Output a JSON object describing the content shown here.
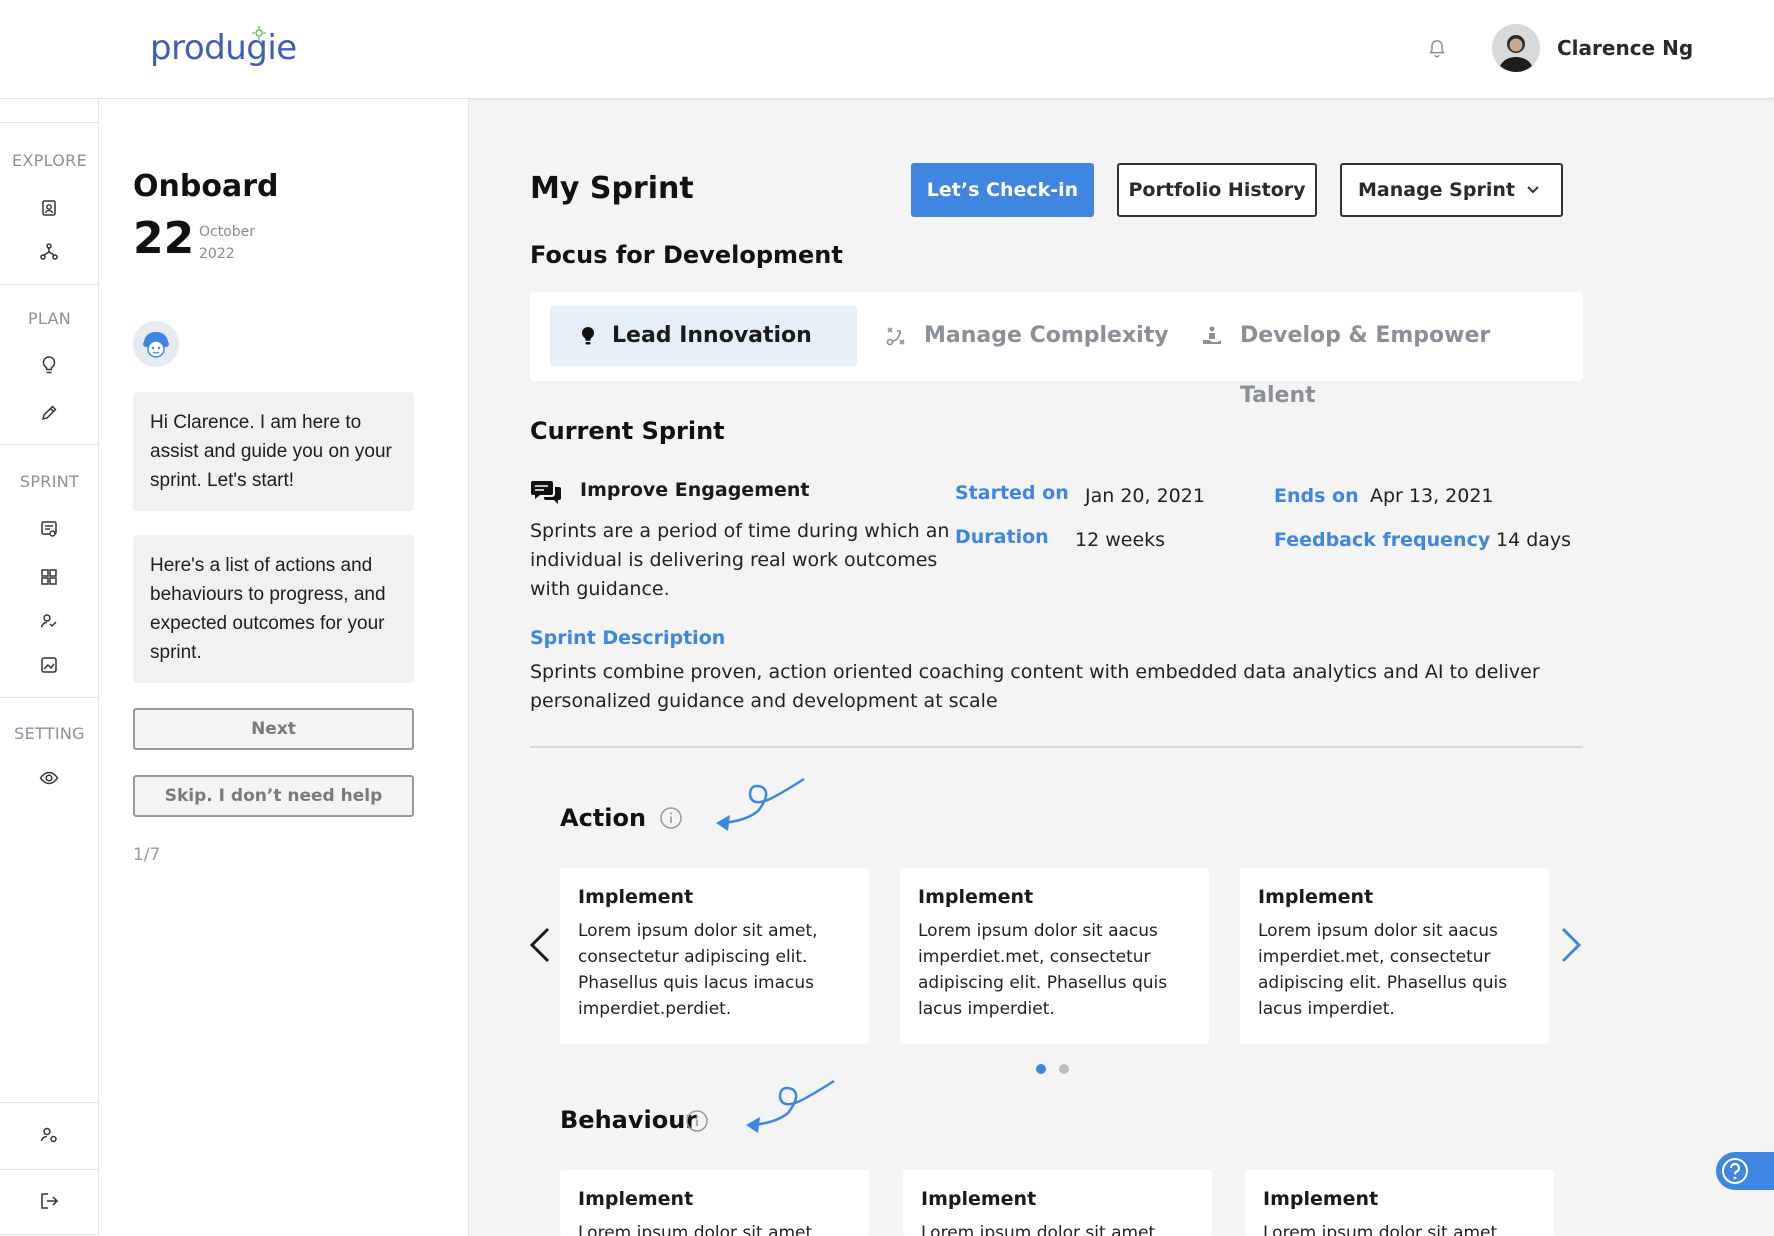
{
  "header": {
    "logo": "produgie",
    "user_name": "Clarence Ng"
  },
  "rail": {
    "sections": [
      {
        "label": "EXPLORE",
        "icons": [
          "profile-badge-icon",
          "org-tree-icon"
        ]
      },
      {
        "label": "PLAN",
        "icons": [
          "lightbulb-icon",
          "pencil-icon"
        ]
      },
      {
        "label": "SPRINT",
        "icons": [
          "sprint-board-icon",
          "grid-icon",
          "person-check-icon",
          "image-chart-icon"
        ]
      },
      {
        "label": "SETTING",
        "icons": [
          "eye-icon"
        ]
      }
    ],
    "bottom_icons": [
      "user-settings-icon",
      "logout-icon"
    ]
  },
  "onboard": {
    "title": "Onboard",
    "day": "22",
    "month": "October",
    "year": "2022",
    "messages": [
      "Hi Clarence. I am here to assist and guide you on your sprint. Let's start!",
      "Here's a list of actions and behaviours to progress, and expected outcomes for your sprint."
    ],
    "next_label": "Next",
    "skip_label": "Skip. I don’t need help",
    "progress": "1/7"
  },
  "main": {
    "title": "My Sprint",
    "checkin_label": "Let’s Check-in",
    "portfolio_label": "Portfolio History",
    "manage_label": "Manage Sprint",
    "focus_heading": "Focus for Development",
    "focus_tabs": [
      {
        "label": "Lead Innovation",
        "icon": "lightbulb-icon",
        "active": true
      },
      {
        "label": "Manage Complexity",
        "icon": "strategy-icon",
        "active": false
      },
      {
        "label": "Develop & Empower Talent",
        "icon": "hand-person-icon",
        "active": false
      }
    ],
    "current_heading": "Current Sprint",
    "sprint": {
      "name": "Improve Engagement",
      "description": "Sprints are a period of time during which an individual is delivering real work outcomes with guidance.",
      "started_label": "Started on",
      "started_value": "Jan 20, 2021",
      "ends_label": "Ends on",
      "ends_value": "Apr 13, 2021",
      "duration_label": "Duration",
      "duration_value": "12 weeks",
      "feedback_label": "Feedback frequency",
      "feedback_value": "14 days",
      "desc_title": "Sprint Description",
      "desc_body": "Sprints combine proven, action oriented coaching content with embedded data analytics and AI to deliver personalized guidance and development at scale"
    },
    "action": {
      "title": "Action",
      "cards": [
        {
          "title": "Implement",
          "body": "Lorem ipsum dolor sit amet, consectetur adipiscing elit. Phasellus quis lacus imacus imperdiet.perdiet."
        },
        {
          "title": "Implement",
          "body": "Lorem ipsum dolor sit aacus imperdiet.met, consectetur adipiscing elit. Phasellus quis lacus imperdiet."
        },
        {
          "title": "Implement",
          "body": "Lorem ipsum dolor sit aacus imperdiet.met, consectetur adipiscing elit. Phasellus quis lacus imperdiet."
        }
      ],
      "page_index": 1,
      "page_count": 2
    },
    "behaviour": {
      "title": "Behaviour",
      "cards": [
        {
          "title": "Implement",
          "body": "Lorem ipsum dolor sit amet"
        },
        {
          "title": "Implement",
          "body": "Lorem ipsum dolor sit amet"
        },
        {
          "title": "Implement",
          "body": "Lorem ipsum dolor sit amet"
        }
      ]
    }
  },
  "colors": {
    "accent": "#3e86e0",
    "active_tab_bg": "#e6eef8",
    "muted_text": "#8b8f98"
  }
}
